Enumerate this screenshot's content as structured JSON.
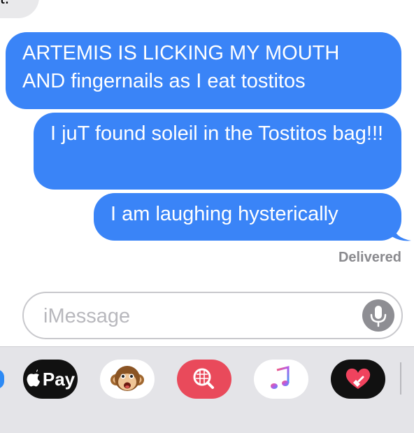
{
  "conversation": {
    "incoming_partial_text": "t.",
    "messages": [
      {
        "from": "me",
        "text": "ARTEMIS IS LICKING MY MOUTH AND fingernails as I eat tostitos"
      },
      {
        "from": "me",
        "text": "I juT found soleil in the Tostitos bag!!!"
      },
      {
        "from": "me",
        "text": "I am laughing hysterically"
      }
    ],
    "status": "Delivered"
  },
  "composer": {
    "placeholder": "iMessage",
    "value": "",
    "mic_icon": "microphone-icon"
  },
  "app_tray": {
    "apps": [
      {
        "name": "app-store-icon"
      },
      {
        "name": "apple-pay-icon",
        "label": "Pay",
        "glyph": ""
      },
      {
        "name": "animoji-monkey-icon"
      },
      {
        "name": "image-search-icon"
      },
      {
        "name": "music-icon"
      },
      {
        "name": "digital-touch-icon"
      }
    ]
  },
  "colors": {
    "outgoing_bubble": "#3a84f7",
    "incoming_bubble": "#e9e9eb",
    "tray_background": "#e4e4e8",
    "status_text": "#8a8a8e"
  }
}
